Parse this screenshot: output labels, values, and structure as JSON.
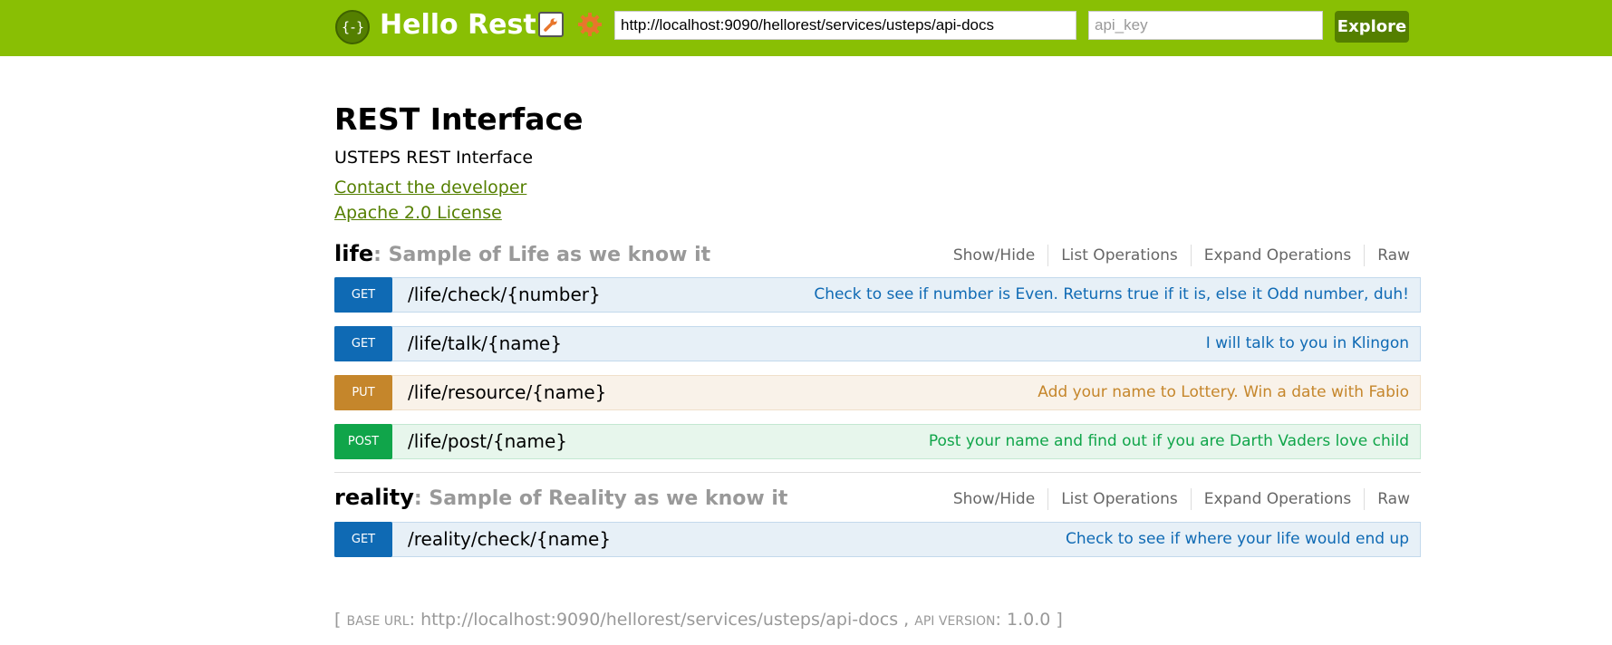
{
  "header": {
    "logo_glyph": "{-}",
    "title": "Hello Rest",
    "url_value": "http://localhost:9090/hellorest/services/usteps/api-docs",
    "api_key_placeholder": "api_key",
    "explore_label": "Explore",
    "colors": {
      "bar": "#89bf04",
      "button": "#547f00"
    }
  },
  "info": {
    "title": "REST Interface",
    "description": "USTEPS REST Interface",
    "contact_link": "Contact the developer",
    "license_link": "Apache 2.0 License"
  },
  "resources": [
    {
      "name": "life",
      "description": ": Sample of Life as we know it",
      "actions": [
        "Show/Hide",
        "List Operations",
        "Expand Operations",
        "Raw"
      ],
      "operations": [
        {
          "method": "GET",
          "path": "/life/check/{number}",
          "summary": "Check to see if number is Even. Returns true if it is, else it Odd number, duh!"
        },
        {
          "method": "GET",
          "path": "/life/talk/{name}",
          "summary": "I will talk to you in Klingon"
        },
        {
          "method": "PUT",
          "path": "/life/resource/{name}",
          "summary": "Add your name to Lottery. Win a date with Fabio"
        },
        {
          "method": "POST",
          "path": "/life/post/{name}",
          "summary": "Post your name and find out if you are Darth Vaders love child"
        }
      ]
    },
    {
      "name": "reality",
      "description": ": Sample of Reality as we know it",
      "actions": [
        "Show/Hide",
        "List Operations",
        "Expand Operations",
        "Raw"
      ],
      "operations": [
        {
          "method": "GET",
          "path": "/reality/check/{name}",
          "summary": "Check to see if where your life would end up"
        }
      ]
    }
  ],
  "footer": {
    "open": "[",
    "base_url_label": "Base URL",
    "base_url": "http://localhost:9090/hellorest/services/usteps/api-docs",
    "api_version_label": "API Version",
    "api_version": "1.0.0",
    "close": "]"
  },
  "method_colors": {
    "GET": "#0f6ab4",
    "PUT": "#c5862b",
    "POST": "#10a54a"
  }
}
